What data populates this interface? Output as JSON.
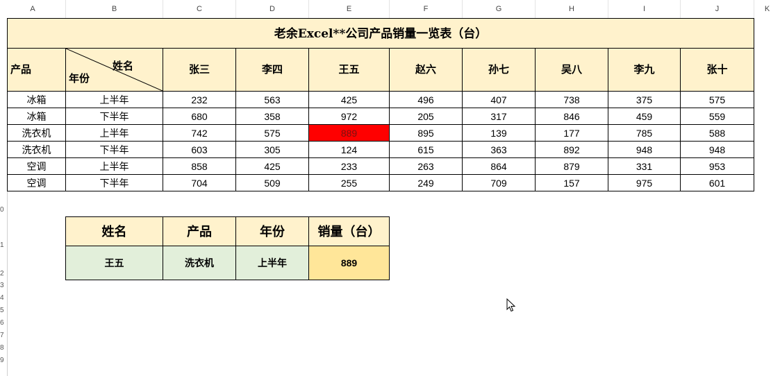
{
  "sheet": {
    "column_letters": [
      "A",
      "B",
      "C",
      "D",
      "E",
      "F",
      "G",
      "H",
      "I",
      "J",
      "K"
    ],
    "row_numbers_visible": [
      "0",
      "1",
      "2",
      "3",
      "4",
      "5",
      "6",
      "7",
      "8",
      "9"
    ]
  },
  "main_table": {
    "title": "老余Excel**公司产品销量一览表（台）",
    "header_product": "产品",
    "header_name": "姓名",
    "header_year": "年份",
    "names": [
      "张三",
      "李四",
      "王五",
      "赵六",
      "孙七",
      "吴八",
      "李九",
      "张十"
    ],
    "rows": [
      {
        "product": "冰箱",
        "period": "上半年",
        "values": [
          "232",
          "563",
          "425",
          "496",
          "407",
          "738",
          "375",
          "575"
        ]
      },
      {
        "product": "冰箱",
        "period": "下半年",
        "values": [
          "680",
          "358",
          "972",
          "205",
          "317",
          "846",
          "459",
          "559"
        ]
      },
      {
        "product": "洗衣机",
        "period": "上半年",
        "values": [
          "742",
          "575",
          "889",
          "895",
          "139",
          "177",
          "785",
          "588"
        ]
      },
      {
        "product": "洗衣机",
        "period": "下半年",
        "values": [
          "603",
          "305",
          "124",
          "615",
          "363",
          "892",
          "948",
          "948"
        ]
      },
      {
        "product": "空调",
        "period": "上半年",
        "values": [
          "858",
          "425",
          "233",
          "263",
          "864",
          "879",
          "331",
          "953"
        ]
      },
      {
        "product": "空调",
        "period": "下半年",
        "values": [
          "704",
          "509",
          "255",
          "249",
          "709",
          "157",
          "975",
          "601"
        ]
      }
    ],
    "highlight_color": "#ff0000"
  },
  "lookup_table": {
    "headers": [
      "姓名",
      "产品",
      "年份",
      "销量（台）"
    ],
    "name": "王五",
    "product": "洗衣机",
    "period": "上半年",
    "result": "889"
  }
}
